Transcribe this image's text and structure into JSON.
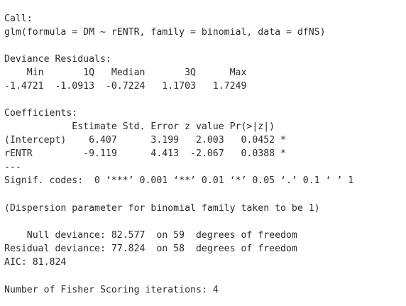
{
  "console": {
    "lines": [
      "Call:",
      "glm(formula = DM ~ rENTR, family = binomial, data = dfNS)",
      "Deviance Residuals:",
      "    Min       1Q   Median       3Q      Max  ",
      "-1.4721  -1.0913  -0.7224   1.1703   1.7249  ",
      "Coefficients:",
      "            Estimate Std. Error z value Pr(>|z|)  ",
      "(Intercept)    6.407      3.199   2.003   0.0452 *",
      "rENTR         -9.119      4.413  -2.067   0.0388 *",
      "---",
      "Signif. codes:  0 ‘***’ 0.001 ‘**’ 0.01 ‘*’ 0.05 ‘.’ 0.1 ‘ ’ 1",
      "(Dispersion parameter for binomial family taken to be 1)",
      "    Null deviance: 82.577  on 59  degrees of freedom",
      "Residual deviance: 77.824  on 58  degrees of freedom",
      "AIC: 81.824",
      "Number of Fisher Scoring iterations: 4"
    ]
  }
}
